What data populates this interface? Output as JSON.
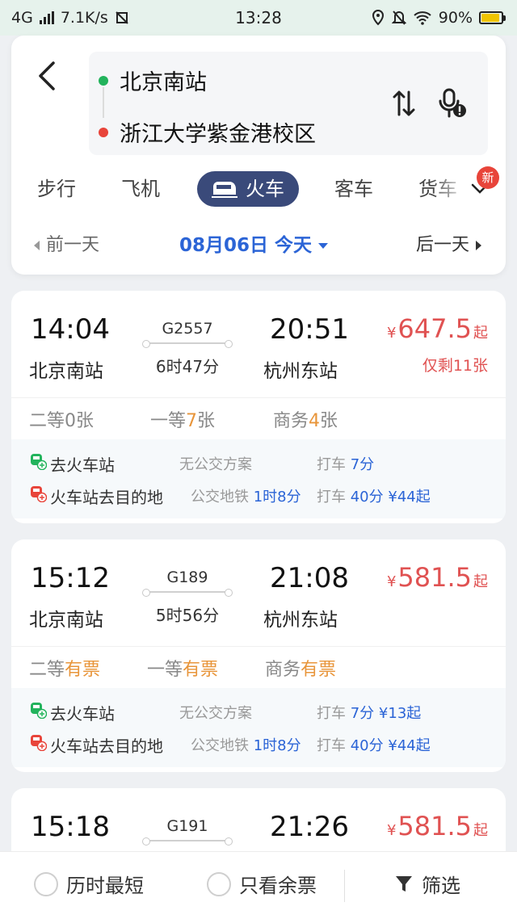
{
  "status_bar": {
    "network": "4G",
    "speed": "7.1K/s",
    "time": "13:28",
    "battery": "90%"
  },
  "header": {
    "from_station": "北京南站",
    "to_station": "浙江大学紫金港校区",
    "modes": [
      {
        "label": "步行"
      },
      {
        "label": "飞机"
      },
      {
        "label": "火车"
      },
      {
        "label": "客车"
      },
      {
        "label": "货车"
      }
    ],
    "new_badge": "新",
    "prev_day": "前一天",
    "date": "08月06日 今天",
    "next_day": "后一天"
  },
  "colors": {
    "from_dot": "#22b35c",
    "to_dot": "#e8443a",
    "active_tab": "#3a4a7a",
    "accent_blue": "#2b64d6",
    "price_red": "#e05252",
    "ticket_orange": "#e8953a"
  },
  "trains": [
    {
      "dep_time": "14:04",
      "dep_station": "北京南站",
      "train_no": "G2557",
      "duration": "6时47分",
      "arr_time": "20:51",
      "arr_station": "杭州东站",
      "price_symbol": "¥",
      "price": "647.5",
      "price_suffix": "起",
      "remain": "仅剩11张",
      "seats": [
        {
          "class": "二等",
          "count": "0",
          "unit": "张"
        },
        {
          "class": "一等",
          "count": "7",
          "unit": "张"
        },
        {
          "class": "商务",
          "count": "4",
          "unit": "张"
        }
      ],
      "to_station": {
        "label": "去火车站",
        "bus": "无公交方案",
        "bus_time": "",
        "taxi": "打车",
        "taxi_time": "7分",
        "taxi_price": ""
      },
      "to_dest": {
        "label": "火车站去目的地",
        "bus": "公交地铁",
        "bus_time": "1时8分",
        "taxi": "打车",
        "taxi_time": "40分",
        "taxi_price": "¥44起"
      }
    },
    {
      "dep_time": "15:12",
      "dep_station": "北京南站",
      "train_no": "G189",
      "duration": "5时56分",
      "arr_time": "21:08",
      "arr_station": "杭州东站",
      "price_symbol": "¥",
      "price": "581.5",
      "price_suffix": "起",
      "remain": "",
      "seats": [
        {
          "class": "二等",
          "count": "有票",
          "unit": ""
        },
        {
          "class": "一等",
          "count": "有票",
          "unit": ""
        },
        {
          "class": "商务",
          "count": "有票",
          "unit": ""
        }
      ],
      "to_station": {
        "label": "去火车站",
        "bus": "无公交方案",
        "bus_time": "",
        "taxi": "打车",
        "taxi_time": "7分",
        "taxi_price": "¥13起"
      },
      "to_dest": {
        "label": "火车站去目的地",
        "bus": "公交地铁",
        "bus_time": "1时8分",
        "taxi": "打车",
        "taxi_time": "40分",
        "taxi_price": "¥44起"
      }
    },
    {
      "dep_time": "15:18",
      "train_no": "G191",
      "arr_time": "21:26",
      "price_symbol": "¥",
      "price": "581.5",
      "price_suffix": "起"
    }
  ],
  "bottom_bar": {
    "shortest": "历时最短",
    "available_only": "只看余票",
    "filter": "筛选"
  }
}
